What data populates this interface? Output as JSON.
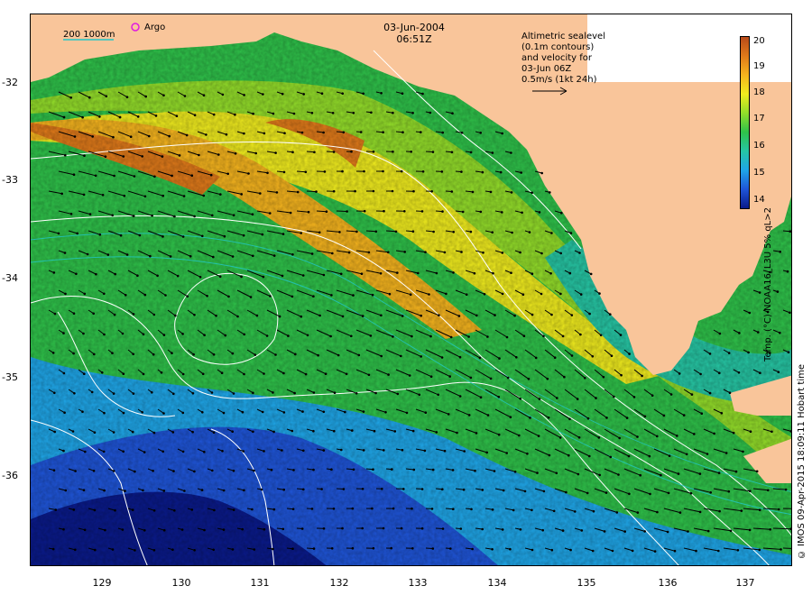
{
  "map": {
    "date": "03-Jun-2004",
    "time": "06:51Z",
    "isobath_label": "200  1000m",
    "argo_label": "Argo",
    "velocity_note": {
      "line1": "Altimetric sealevel",
      "line2": "(0.1m contours)",
      "line3": "and velocity for",
      "line4": "03-Jun 06Z",
      "line5": "0.5m/s (1kt 24h)"
    },
    "credit": "© IMOS 09-Apr-2015 18:09:11 Hobart time"
  },
  "axes": {
    "x_ticks": [
      "129",
      "130",
      "131",
      "132",
      "133",
      "134",
      "135",
      "136",
      "137"
    ],
    "y_ticks": [
      "-32",
      "-33",
      "-34",
      "-35",
      "-36"
    ]
  },
  "colorbar": {
    "title": "Temp. (°C) NOAA16_L3U 5% qL>2",
    "ticks": [
      "20",
      "19",
      "18",
      "17",
      "16",
      "15",
      "14"
    ],
    "range": [
      13.8,
      20.2
    ],
    "colors": [
      "#0a1a8a",
      "#1f55d8",
      "#1fa6e8",
      "#26c6a4",
      "#2fc24a",
      "#93dd2a",
      "#f0ec1e",
      "#f5b41e",
      "#e07a1a",
      "#b84a1a"
    ]
  },
  "colors": {
    "land": "#f9c59a",
    "arrow": "#000000",
    "contour": "#ffffff",
    "isobath": "#22c7c7",
    "argo": "#e01ae0"
  }
}
